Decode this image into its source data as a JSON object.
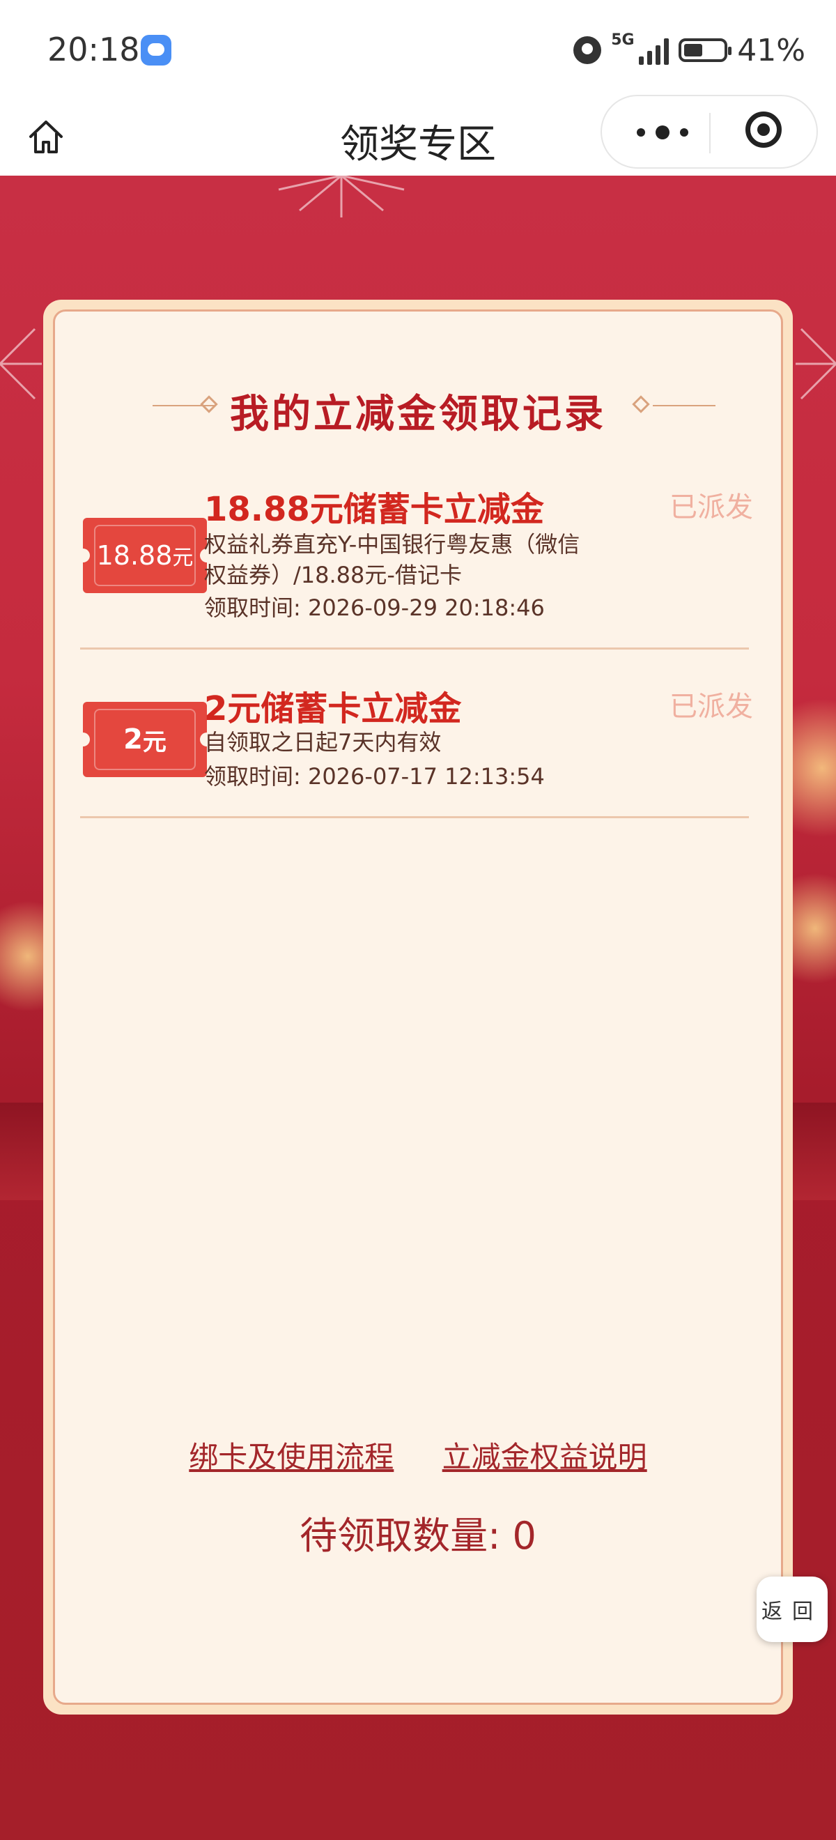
{
  "status_bar": {
    "time": "20:18",
    "network": "5G",
    "battery": "41%",
    "battery_level": 0.41
  },
  "nav": {
    "title": "领奖专区"
  },
  "card": {
    "title": "我的立减金领取记录",
    "records": [
      {
        "ticket_amount": "18.88",
        "ticket_unit": "元",
        "title": "18.88元储蓄卡立减金",
        "desc": "权益礼券直充Y-中国银行粤友惠（微信权益券）/18.88元-借记卡",
        "time": "领取时间: 2026-09-29 20:18:46",
        "status": "已派发"
      },
      {
        "ticket_amount": "2",
        "ticket_unit": "元",
        "title": "2元储蓄卡立减金",
        "desc": "自领取之日起7天内有效",
        "time": "领取时间: 2026-07-17 12:13:54",
        "status": "已派发"
      }
    ],
    "links": {
      "bind_flow": "绑卡及使用流程",
      "rights_desc": "立减金权益说明"
    },
    "pending": "待领取数量: 0"
  },
  "back_button": "返回",
  "colors": {
    "accent_red": "#d2271f",
    "ticket_red": "#e4473e",
    "card_bg": "#fdf3e8",
    "page_bg": "#c52b3e"
  }
}
